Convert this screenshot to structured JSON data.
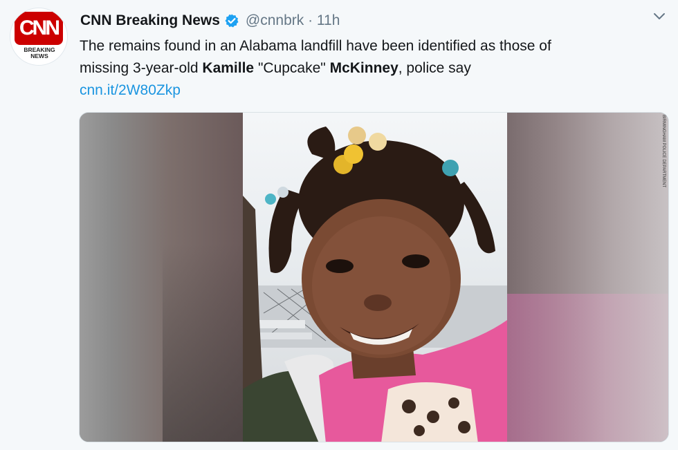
{
  "tweet": {
    "account_name": "CNN Breaking News",
    "handle_time": "@cnnbrk · 11h",
    "text_line1": "The remains found in an Alabama landfill have been identified as those of",
    "text_line2_prefix": "missing 3-year-old ",
    "text_bold1": "Kamille",
    "text_mid": " \"Cupcake\" ",
    "text_bold2": "McKinney",
    "text_suffix": ", police say",
    "link": "cnn.it/2W80Zkp"
  },
  "avatar": {
    "logo_text": "CNN",
    "sub_line1": "BREAKING",
    "sub_line2": "NEWS"
  },
  "media": {
    "photo_credit": "BIRMINGHAM POLICE DEPARTMENT"
  },
  "icons": {
    "verified": "verified-badge-icon",
    "menu": "chevron-down-icon"
  },
  "colors": {
    "accent_link": "#1b95e0",
    "verified_blue": "#1da1f2",
    "brand_red": "#cc0000"
  }
}
